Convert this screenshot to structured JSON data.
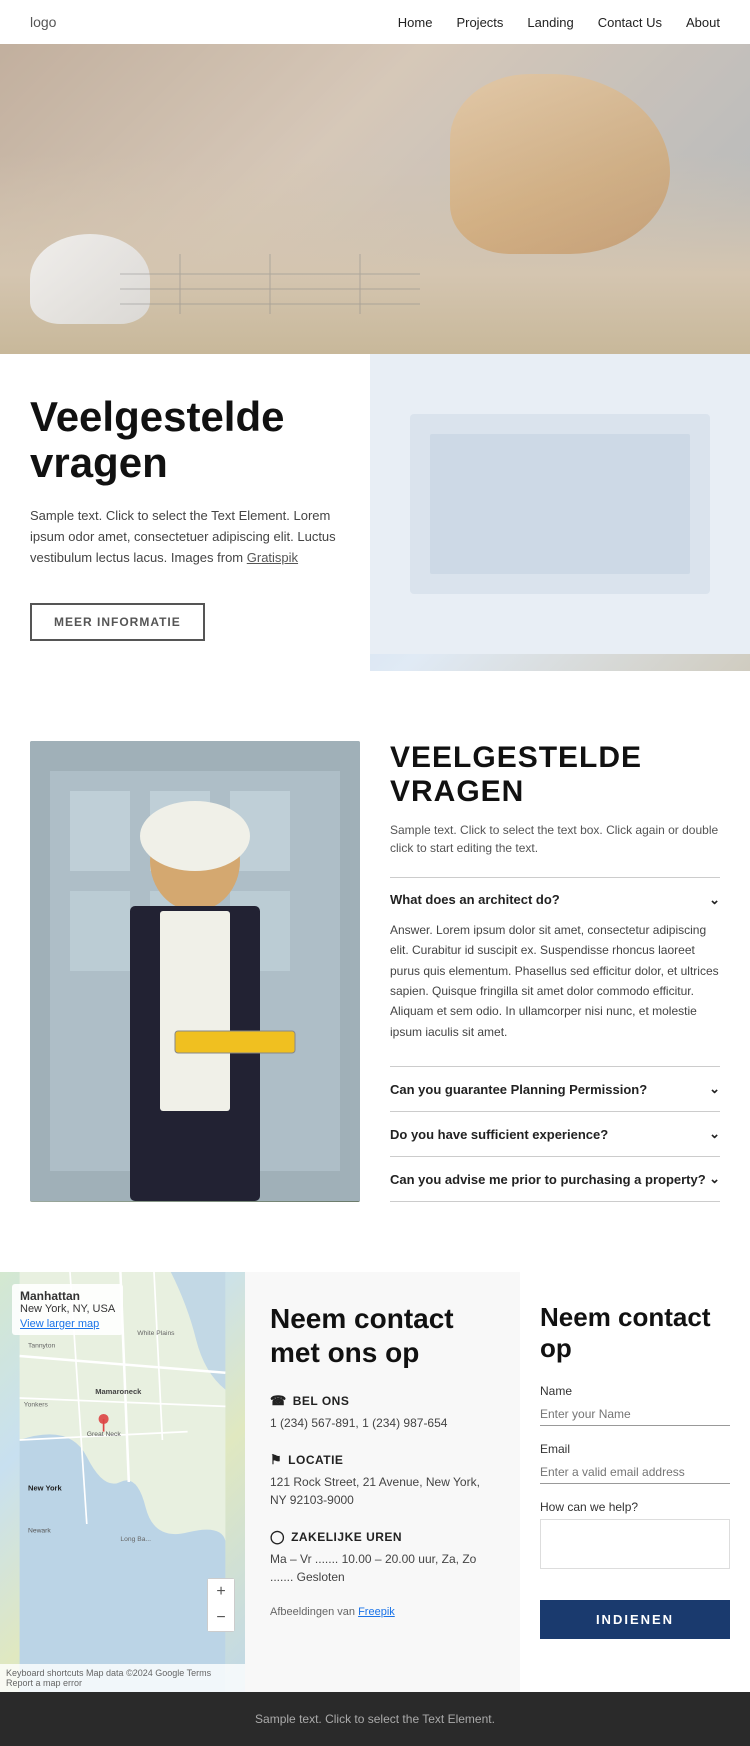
{
  "nav": {
    "logo": "logo",
    "links": [
      {
        "label": "Home",
        "href": "#"
      },
      {
        "label": "Projects",
        "href": "#"
      },
      {
        "label": "Landing",
        "href": "#"
      },
      {
        "label": "Contact Us",
        "href": "#"
      },
      {
        "label": "About",
        "href": "#"
      }
    ]
  },
  "faq_intro": {
    "heading_line1": "Veelgestelde",
    "heading_line2": "vragen",
    "body": "Sample text. Click to select the Text Element. Lorem ipsum odor amet, consectetuer adipiscing elit. Luctus vestibulum lectus lacus. Images from Gratispik",
    "link_text": "Gratispik",
    "button_label": "MEER INFORMATIE"
  },
  "faq_detail": {
    "heading": "VEELGESTELDE VRAGEN",
    "subtitle": "Sample text. Click to select the text box. Click again or double click to start editing the text.",
    "items": [
      {
        "question": "What does an architect do?",
        "answer": "Answer. Lorem ipsum dolor sit amet, consectetur adipiscing elit. Curabitur id suscipit ex. Suspendisse rhoncus laoreet purus quis elementum. Phasellus sed efficitur dolor, et ultrices sapien. Quisque fringilla sit amet dolor commodo efficitur. Aliquam et sem odio. In ullamcorper nisi nunc, et molestie ipsum iaculis sit amet.",
        "open": true
      },
      {
        "question": "Can you guarantee Planning Permission?",
        "answer": "",
        "open": false
      },
      {
        "question": "Do you have sufficient experience?",
        "answer": "",
        "open": false
      },
      {
        "question": "Can you advise me prior to purchasing a property?",
        "answer": "",
        "open": false
      }
    ]
  },
  "contact_info": {
    "heading": "Neem contact met ons op",
    "bel_title": "BEL ONS",
    "bel_phone": "1 (234) 567-891, 1 (234) 987-654",
    "locatie_title": "LOCATIE",
    "locatie_address": "121 Rock Street, 21 Avenue, New York, NY 92103-9000",
    "uren_title": "ZAKELIJKE UREN",
    "uren_text": "Ma – Vr ....... 10.00 – 20.00 uur, Za, Zo ....... Gesloten",
    "attribution": "Afbeeldingen van Freepik",
    "attribution_link": "Freepik"
  },
  "map": {
    "label": "Manhattan",
    "sublabel": "New York, NY, USA",
    "view_larger": "View larger map",
    "copyright": "Keyboard shortcuts  Map data ©2024 Google  Terms  Report a map error"
  },
  "contact_form": {
    "heading": "Neem contact op",
    "name_label": "Name",
    "name_placeholder": "Enter your Name",
    "email_label": "Email",
    "email_placeholder": "Enter a valid email address",
    "help_label": "How can we help?",
    "help_placeholder": "",
    "submit_label": "INDIENEN"
  },
  "footer": {
    "text": "Sample text. Click to select the Text Element."
  }
}
